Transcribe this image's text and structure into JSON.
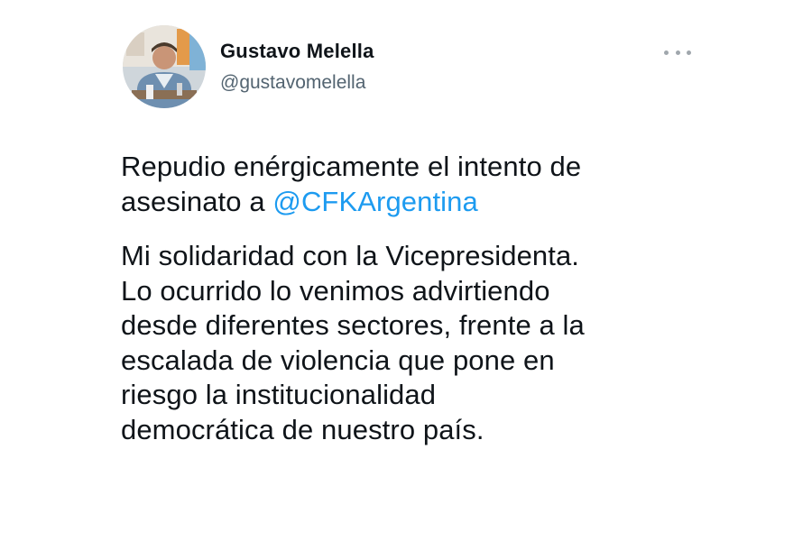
{
  "tweet": {
    "author": {
      "display_name": "Gustavo Melella",
      "handle": "@gustavomelella",
      "avatar_icon": "profile-photo"
    },
    "more_icon": "more-options-icon",
    "paragraph1": {
      "lines": [
        "Repudio enérgicamente el intento de",
        "asesinato a "
      ],
      "mention": "@CFKArgentina"
    },
    "paragraph2": {
      "lines": [
        "Mi solidaridad con la Vicepresidenta.",
        "Lo ocurrido lo venimos advirtiendo",
        "desde diferentes sectores, frente a la",
        "escalada de violencia que pone en",
        "riesgo la institucionalidad",
        "democrática de nuestro país."
      ]
    }
  },
  "colors": {
    "text": "#0f1419",
    "secondary": "#536471",
    "link": "#1d9bf0",
    "background": "#ffffff"
  }
}
